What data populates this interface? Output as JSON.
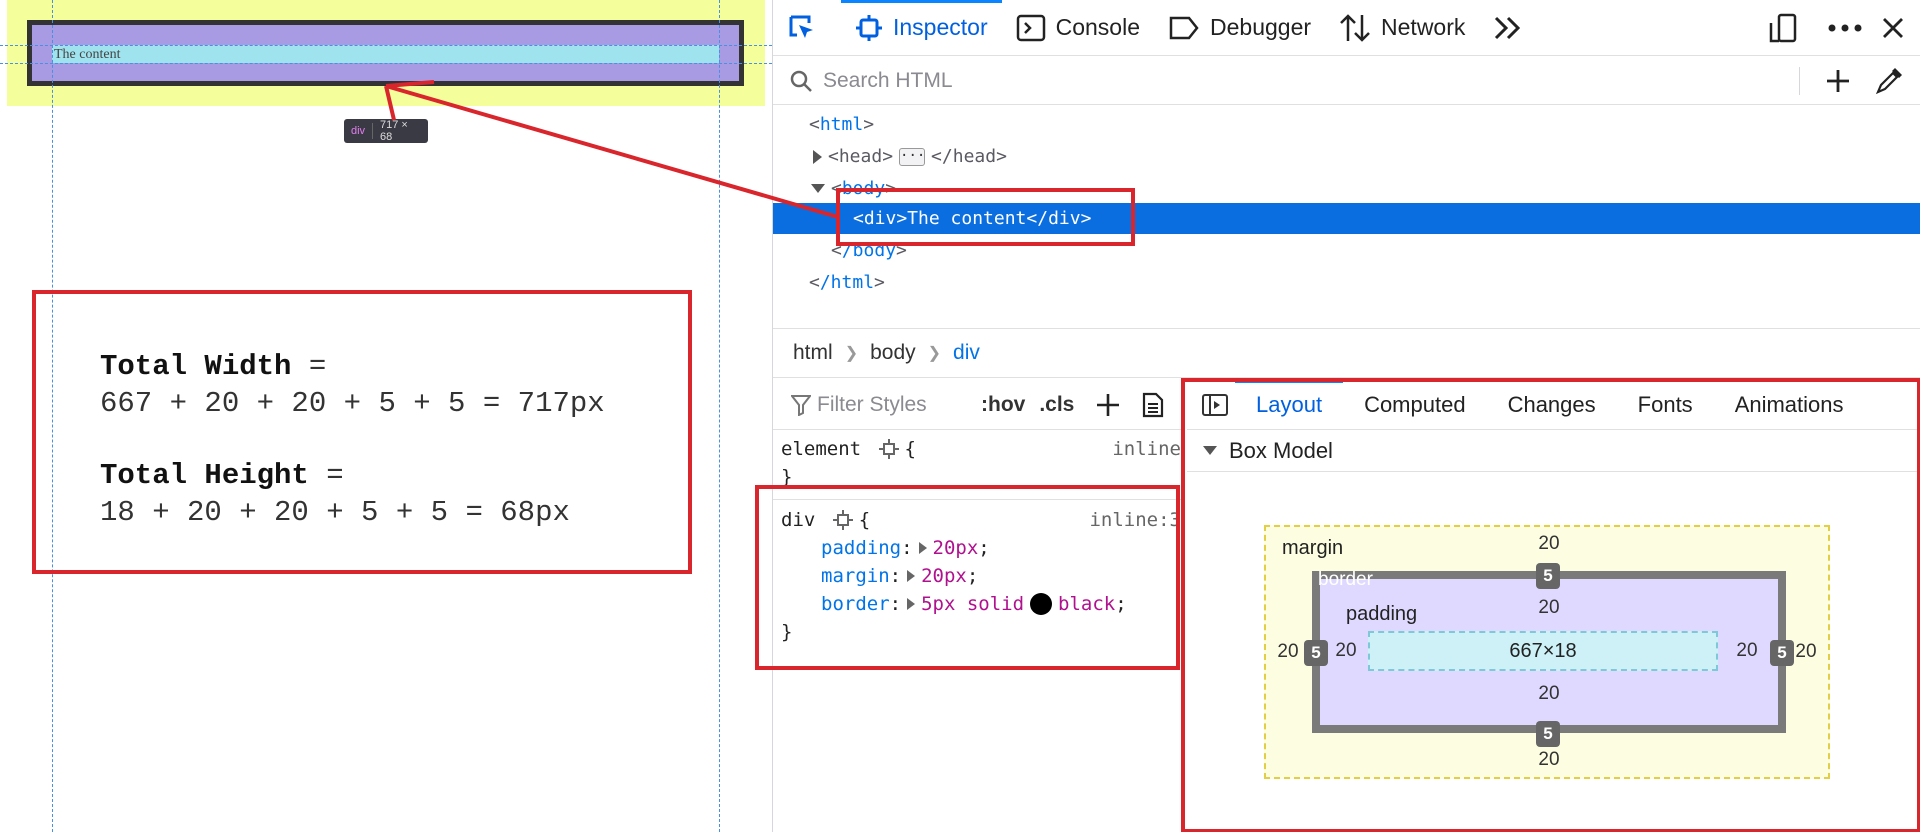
{
  "page": {
    "content_text": "The content",
    "tooltip_tag": "div",
    "tooltip_dims": "717 × 68",
    "formula": {
      "width_label": "Total Width",
      "width_eq": " =",
      "width_expr": "667 + 20 + 20 + 5 + 5 = 717px",
      "height_label": "Total Height",
      "height_eq": " =",
      "height_expr": "18 + 20 + 20 + 5 + 5 = 68px"
    }
  },
  "toolbar": {
    "tabs": [
      "Inspector",
      "Console",
      "Debugger",
      "Network"
    ],
    "icons": [
      "element-picker-icon",
      "inspector-icon",
      "console-icon",
      "debugger-icon",
      "network-icon",
      "more-tools-icon",
      "responsive-mode-icon",
      "menu-icon",
      "close-icon"
    ]
  },
  "search": {
    "placeholder": "Search HTML"
  },
  "markup": {
    "html_open": "html",
    "head_open": "head",
    "head_close": "/head",
    "body_open": "body",
    "div_line": "<div>The content</div>",
    "body_close": "/body",
    "html_close": "/html"
  },
  "breadcrumbs": [
    "html",
    "body",
    "div"
  ],
  "rules": {
    "filter_placeholder": "Filter Styles",
    "hov": ":hov",
    "cls": ".cls",
    "element_selector": "element",
    "element_source": "inline",
    "div_selector": "div",
    "div_source": "inline:3",
    "declarations": [
      {
        "prop": "padding",
        "value": "20px"
      },
      {
        "prop": "margin",
        "value": "20px"
      },
      {
        "prop": "border",
        "value": "5px solid",
        "value2": "black"
      }
    ],
    "swatch_color": "#000000"
  },
  "layout": {
    "tabs": [
      "Layout",
      "Computed",
      "Changes",
      "Fonts",
      "Animations"
    ],
    "box_model_title": "Box Model",
    "margin_label": "margin",
    "border_label": "border",
    "padding_label": "padding",
    "margin": {
      "top": "20",
      "right": "20",
      "bottom": "20",
      "left": "20"
    },
    "border": {
      "top": "5",
      "right": "5",
      "bottom": "5",
      "left": "5"
    },
    "padding": {
      "top": "20",
      "right": "20",
      "bottom": "20",
      "left": "20"
    },
    "content_size": "667×18"
  },
  "colors": {
    "accent": "#0a84ff",
    "selection": "#0a6ee0",
    "annotation": "#d9262c",
    "margin_area": "#f4ff9c",
    "border_area": "#a89be3",
    "content_area": "#9fe3ee"
  }
}
